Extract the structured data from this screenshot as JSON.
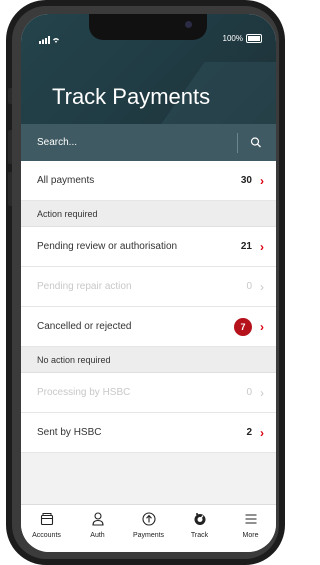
{
  "status_bar": {
    "signal": "••••",
    "battery": "100%"
  },
  "header": {
    "title": "Track Payments"
  },
  "search": {
    "placeholder": "Search..."
  },
  "list": {
    "all_payments": {
      "label": "All payments",
      "count": "30"
    },
    "sections": [
      {
        "title": "Action required",
        "rows": [
          {
            "label": "Pending review or authorisation",
            "count": "21",
            "enabled": true
          },
          {
            "label": "Pending repair action",
            "count": "0",
            "enabled": false
          },
          {
            "label": "Cancelled or rejected",
            "count": "7",
            "enabled": true,
            "badge": true
          }
        ]
      },
      {
        "title": "No action required",
        "rows": [
          {
            "label": "Processing by HSBC",
            "count": "0",
            "enabled": false
          },
          {
            "label": "Sent by HSBC",
            "count": "2",
            "enabled": true
          }
        ]
      }
    ]
  },
  "tab_bar": [
    {
      "label": "Accounts",
      "icon": "wallet-icon"
    },
    {
      "label": "Auth",
      "icon": "user-key-icon"
    },
    {
      "label": "Payments",
      "icon": "arrow-up-circle-icon"
    },
    {
      "label": "Track",
      "icon": "gauge-icon"
    },
    {
      "label": "More",
      "icon": "menu-icon"
    }
  ],
  "colors": {
    "header": "#24434b",
    "search": "#3f5a62",
    "accent": "#db0011",
    "badge": "#b5121b"
  }
}
